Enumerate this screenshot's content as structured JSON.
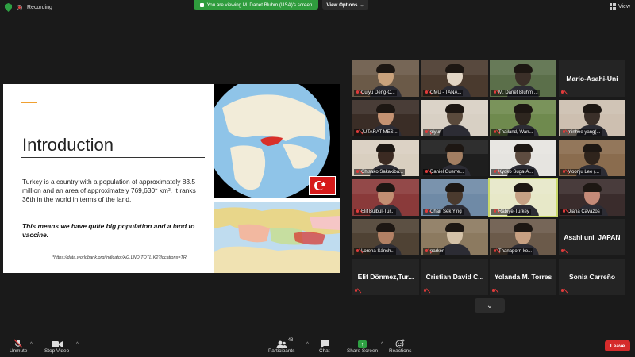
{
  "topbar": {
    "recording_label": "Recording",
    "share_banner": "You are viewing M. Danet Bluhm (USA)'s screen",
    "view_options": "View Options",
    "view_label": "View"
  },
  "slide": {
    "title": "Introduction",
    "body": "Turkey is a country with a population of approximately 83.5 million and an area of approximately 769,630* km². It ranks 36th in the world in terms of the land.",
    "bold": "This means we have quite big population and a land to vaccine.",
    "footnote": "*https://data.worldbank.org/indicator/AG.LND.TOTL.K2?locations=TR"
  },
  "participants": [
    {
      "name": "Cuiyu Deng-C...",
      "type": "video"
    },
    {
      "name": "CMU - TANA...",
      "type": "video"
    },
    {
      "name": "M. Danet Bluhm ...",
      "type": "video"
    },
    {
      "name": "Mario-Asahi-Uni",
      "type": "name"
    },
    {
      "name": "JUTARAT MES...",
      "type": "video"
    },
    {
      "name": "piyun",
      "type": "video"
    },
    {
      "name": "Thailand, Wan...",
      "type": "video"
    },
    {
      "name": "minhee yang(...",
      "type": "video"
    },
    {
      "name": "Chisako Sakakiba...",
      "type": "video"
    },
    {
      "name": "Daniel Guerre...",
      "type": "video"
    },
    {
      "name": "Kyoko Suga-A...",
      "type": "video"
    },
    {
      "name": "Moonju Lee (...",
      "type": "video"
    },
    {
      "name": "Elif Bülbül-Tur...",
      "type": "video"
    },
    {
      "name": "Chair Sek Ying",
      "type": "video"
    },
    {
      "name": "Rabiye-Turkey",
      "type": "video"
    },
    {
      "name": "Diana Cavazos",
      "type": "video"
    },
    {
      "name": "Lorena Sánch...",
      "type": "video"
    },
    {
      "name": "parker",
      "type": "video"
    },
    {
      "name": "Thanaporn ko...",
      "type": "video"
    },
    {
      "name": "Asahi uni_JAPAN",
      "type": "name"
    },
    {
      "name": "Elif Dönmez,Tur...",
      "type": "name"
    },
    {
      "name": "Cristian David C...",
      "type": "name"
    },
    {
      "name": "Yolanda M. Torres",
      "type": "name"
    },
    {
      "name": "Sonia Carreño",
      "type": "name"
    }
  ],
  "toolbar": {
    "unmute": "Unmute",
    "stop_video": "Stop Video",
    "participants": "Participants",
    "participants_count": "48",
    "chat": "Chat",
    "share_screen": "Share Screen",
    "reactions": "Reactions",
    "leave": "Leave"
  },
  "colors": {
    "accent_orange": "#f0a030",
    "share_green": "#2f9c3d",
    "leave_red": "#d52b2b",
    "active_speaker": "#c9d86b"
  }
}
